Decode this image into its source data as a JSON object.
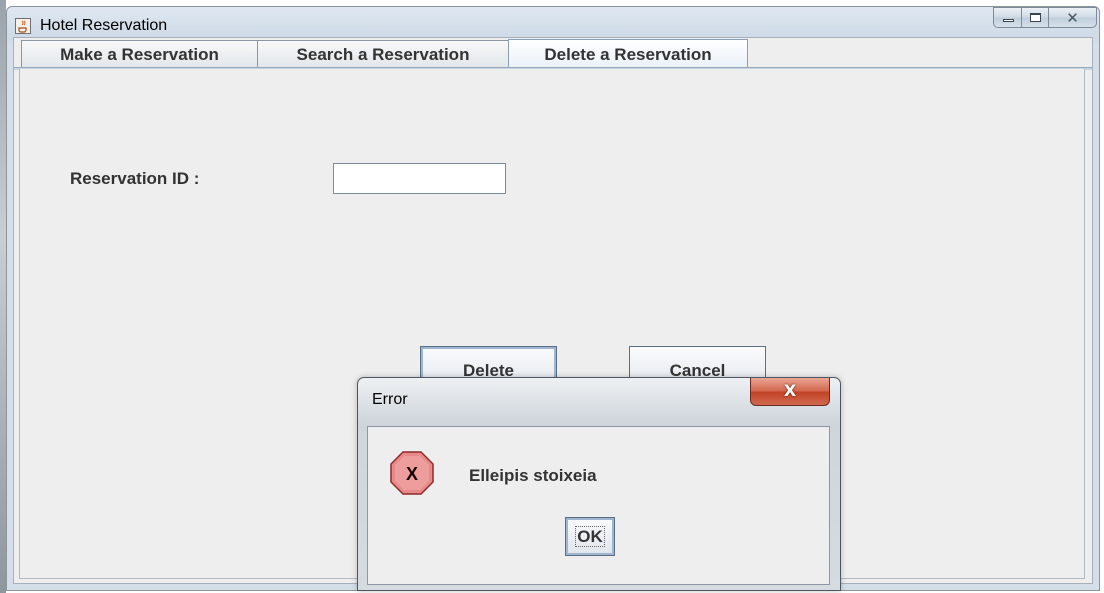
{
  "window": {
    "title": "Hotel Reservation",
    "icon": "java-cup-icon",
    "controls": {
      "minimize": "minimize-icon",
      "maximize": "maximize-icon",
      "close_glyph": "✕"
    }
  },
  "tabs": [
    {
      "label": "Make a Reservation",
      "selected": false
    },
    {
      "label": "Search a Reservation",
      "selected": false
    },
    {
      "label": "Delete a Reservation",
      "selected": true
    }
  ],
  "delete_panel": {
    "reservation_id_label": "Reservation ID :",
    "reservation_id_value": "",
    "delete_button": "Delete",
    "cancel_button": "Cancel"
  },
  "dialog": {
    "title": "Error",
    "close_glyph": "X",
    "icon": "error-icon",
    "icon_glyph": "X",
    "message": "Elleipis stoixeia",
    "ok_button": "OK"
  }
}
